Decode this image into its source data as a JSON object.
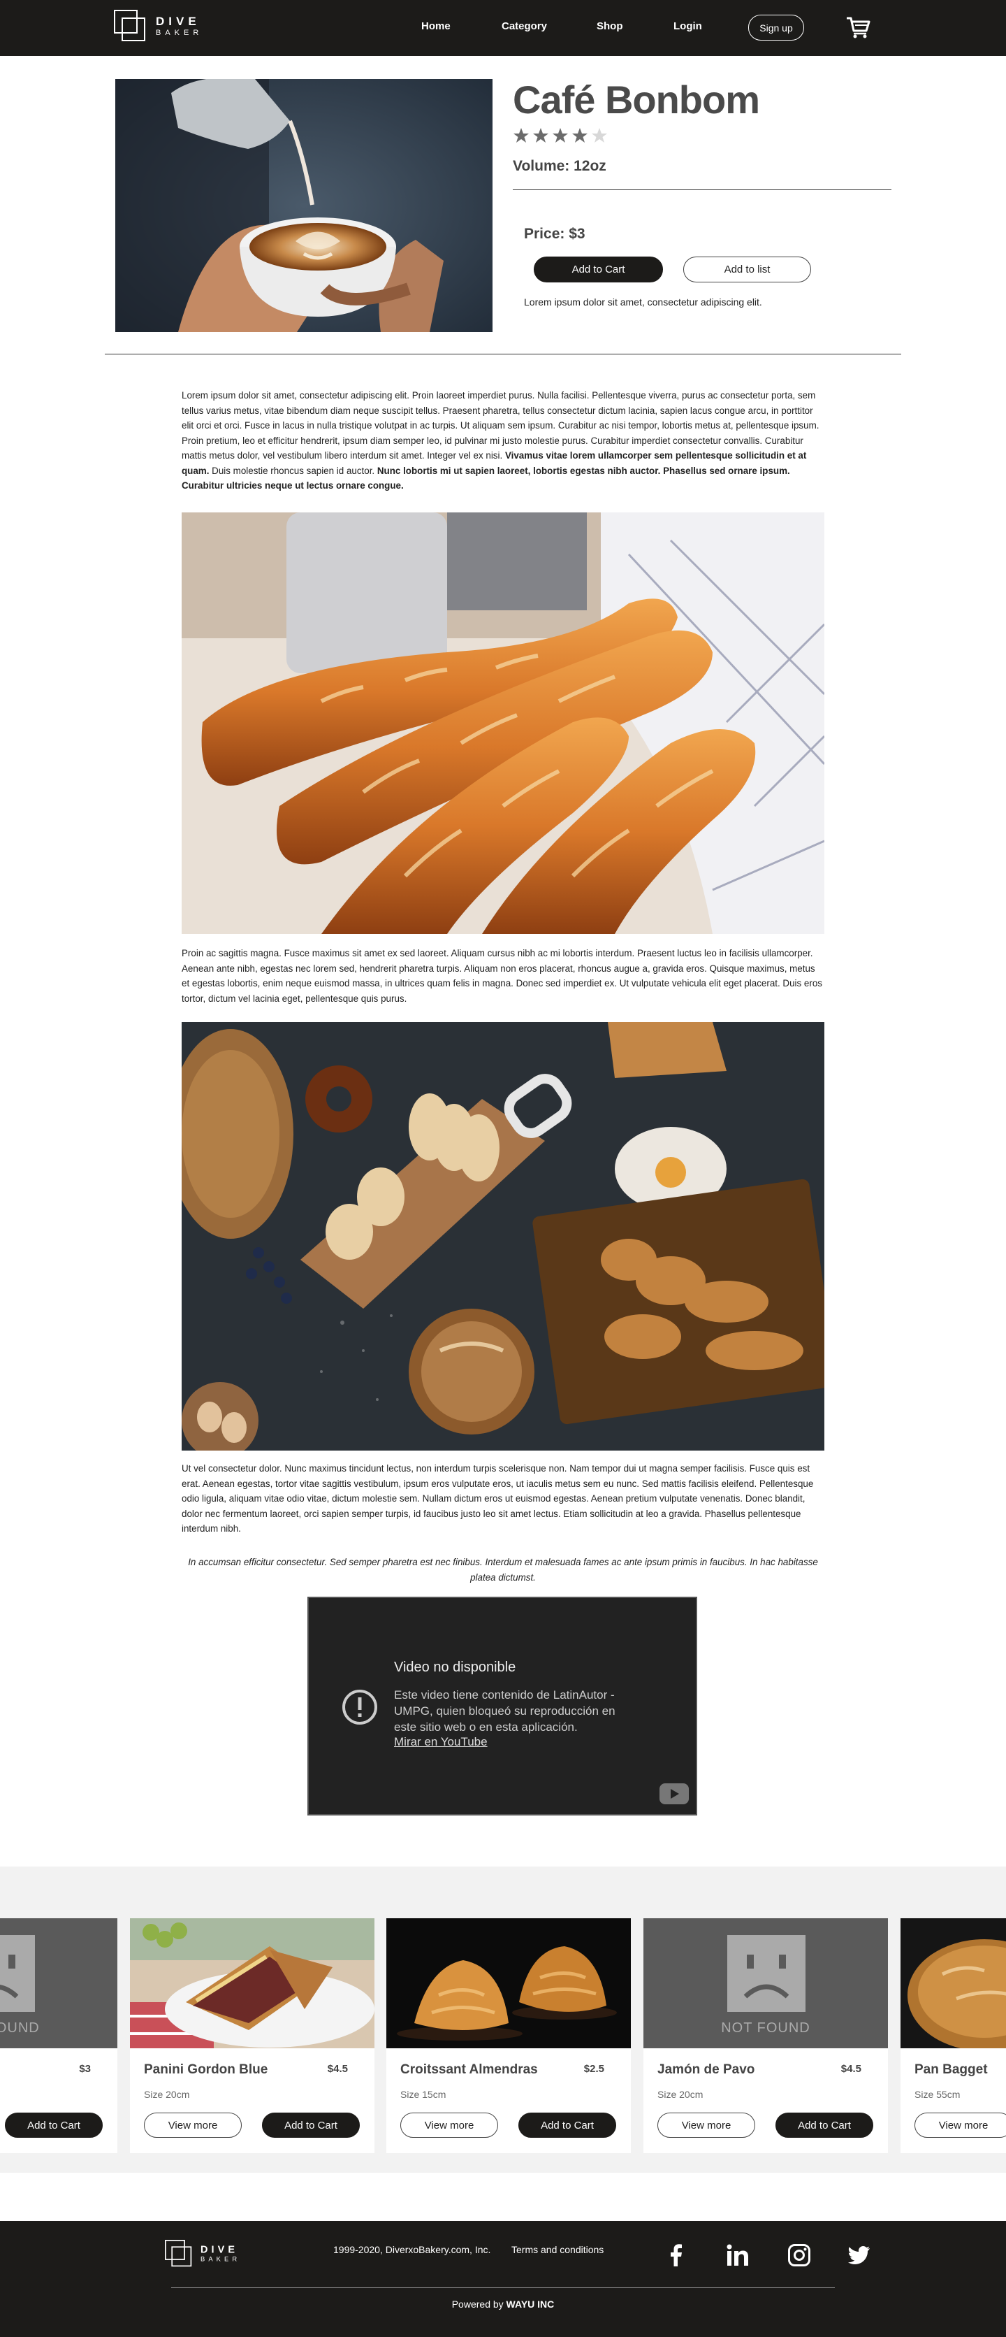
{
  "brand": {
    "line1": "DIVE",
    "line2": "BAKER"
  },
  "nav": {
    "items": [
      {
        "label": "Home"
      },
      {
        "label": "Category"
      },
      {
        "label": "Shop"
      },
      {
        "label": "Login"
      }
    ],
    "signup": "Sign up",
    "cart_icon": "cart-icon"
  },
  "product": {
    "title": "Café Bonbom",
    "rating": 4,
    "rating_max": 5,
    "volume": "Volume: 12oz",
    "price": "Price: $3",
    "add_to_cart": "Add to Cart",
    "add_to_list": "Add to list",
    "short_desc": "Lorem ipsum dolor sit amet, consectetur adipiscing elit."
  },
  "article": {
    "p1_a": "Lorem ipsum dolor sit amet, consectetur adipiscing elit. Proin laoreet imperdiet purus. Nulla facilisi. Pellentesque viverra, purus ac consectetur porta, sem tellus varius metus, vitae bibendum diam neque suscipit tellus. Praesent pharetra, tellus consectetur dictum lacinia, sapien lacus congue arcu, in porttitor elit orci et orci. Fusce in lacus in nulla tristique volutpat in ac turpis. Ut aliquam sem ipsum. Curabitur ac nisi tempor, lobortis metus at, pellentesque ipsum. Proin pretium, leo et efficitur hendrerit, ipsum diam semper leo, id pulvinar mi justo molestie purus. Curabitur imperdiet consectetur convallis. Curabitur mattis metus dolor, vel vestibulum libero interdum sit amet. Integer vel ex nisi.",
    "p1_b": "Vivamus vitae lorem ullamcorper sem pellentesque sollicitudin et at quam.",
    "p1_c": "Duis molestie rhoncus sapien id auctor.",
    "p1_d": "Nunc lobortis mi ut sapien laoreet, lobortis egestas nibh auctor. Phasellus sed ornare ipsum. Curabitur ultricies neque ut lectus ornare congue.",
    "p2": "Proin ac sagittis magna. Fusce maximus sit amet ex sed laoreet. Aliquam cursus nibh ac mi lobortis interdum. Praesent luctus leo in facilisis ullamcorper. Aenean ante nibh, egestas nec lorem sed, hendrerit pharetra turpis. Aliquam non eros placerat, rhoncus augue a, gravida eros. Quisque maximus, metus et egestas lobortis, enim neque euismod massa, in ultrices quam felis in magna. Donec sed imperdiet ex. Ut vulputate vehicula elit eget placerat. Duis eros tortor, dictum vel lacinia eget, pellentesque quis purus.",
    "p3": "Ut vel consectetur dolor. Nunc maximus tincidunt lectus, non interdum turpis scelerisque non. Nam tempor dui ut magna semper facilisis. Fusce quis est erat. Aenean egestas, tortor vitae sagittis vestibulum, ipsum eros vulputate eros, ut iaculis metus sem eu nunc. Sed mattis facilisis eleifend. Pellentesque odio ligula, aliquam vitae odio vitae, dictum molestie sem. Nullam dictum eros ut euismod egestas. Aenean pretium vulputate venenatis. Donec blandit, dolor nec fermentum laoreet, orci sapien semper turpis, id faucibus justo leo sit amet lectus. Etiam sollicitudin at leo a gravida. Phasellus pellentesque interdum nibh.",
    "quote": "In accumsan efficitur consectetur. Sed semper pharetra est nec finibus. Interdum et malesuada fames ac ante ipsum primis in faucibus. In hac habitasse platea dictumst."
  },
  "video": {
    "title": "Video no disponible",
    "message": "Este video tiene contenido de LatinAutor - UMPG, quien bloqueó su reproducción en este sitio web o en esta aplicación.",
    "link": "Mirar en YouTube"
  },
  "carousel": {
    "not_found": "NOT FOUND",
    "view_more": "View more",
    "add_to_cart": "Add to Cart",
    "cards": [
      {
        "name": "",
        "price": "$3",
        "size": ""
      },
      {
        "name": "Panini Gordon Blue",
        "price": "$4.5",
        "size": "Size 20cm"
      },
      {
        "name": "Croitssant Almendras",
        "price": "$2.5",
        "size": "Size 15cm"
      },
      {
        "name": "Jamón de Pavo",
        "price": "$4.5",
        "size": "Size 20cm"
      },
      {
        "name": "Pan Bagget",
        "price": "",
        "size": "Size 55cm"
      }
    ]
  },
  "footer": {
    "copyright": "1999-2020, DiverxoBakery.com, Inc.",
    "terms": "Terms and conditions",
    "powered_prefix": "Powered by",
    "powered_company": "WAYU INC",
    "social_icons": [
      "facebook-icon",
      "linkedin-icon",
      "instagram-icon",
      "twitter-icon"
    ]
  },
  "colors": {
    "dark": "#1c1b19",
    "carousel_bg": "#f2f2f2"
  }
}
